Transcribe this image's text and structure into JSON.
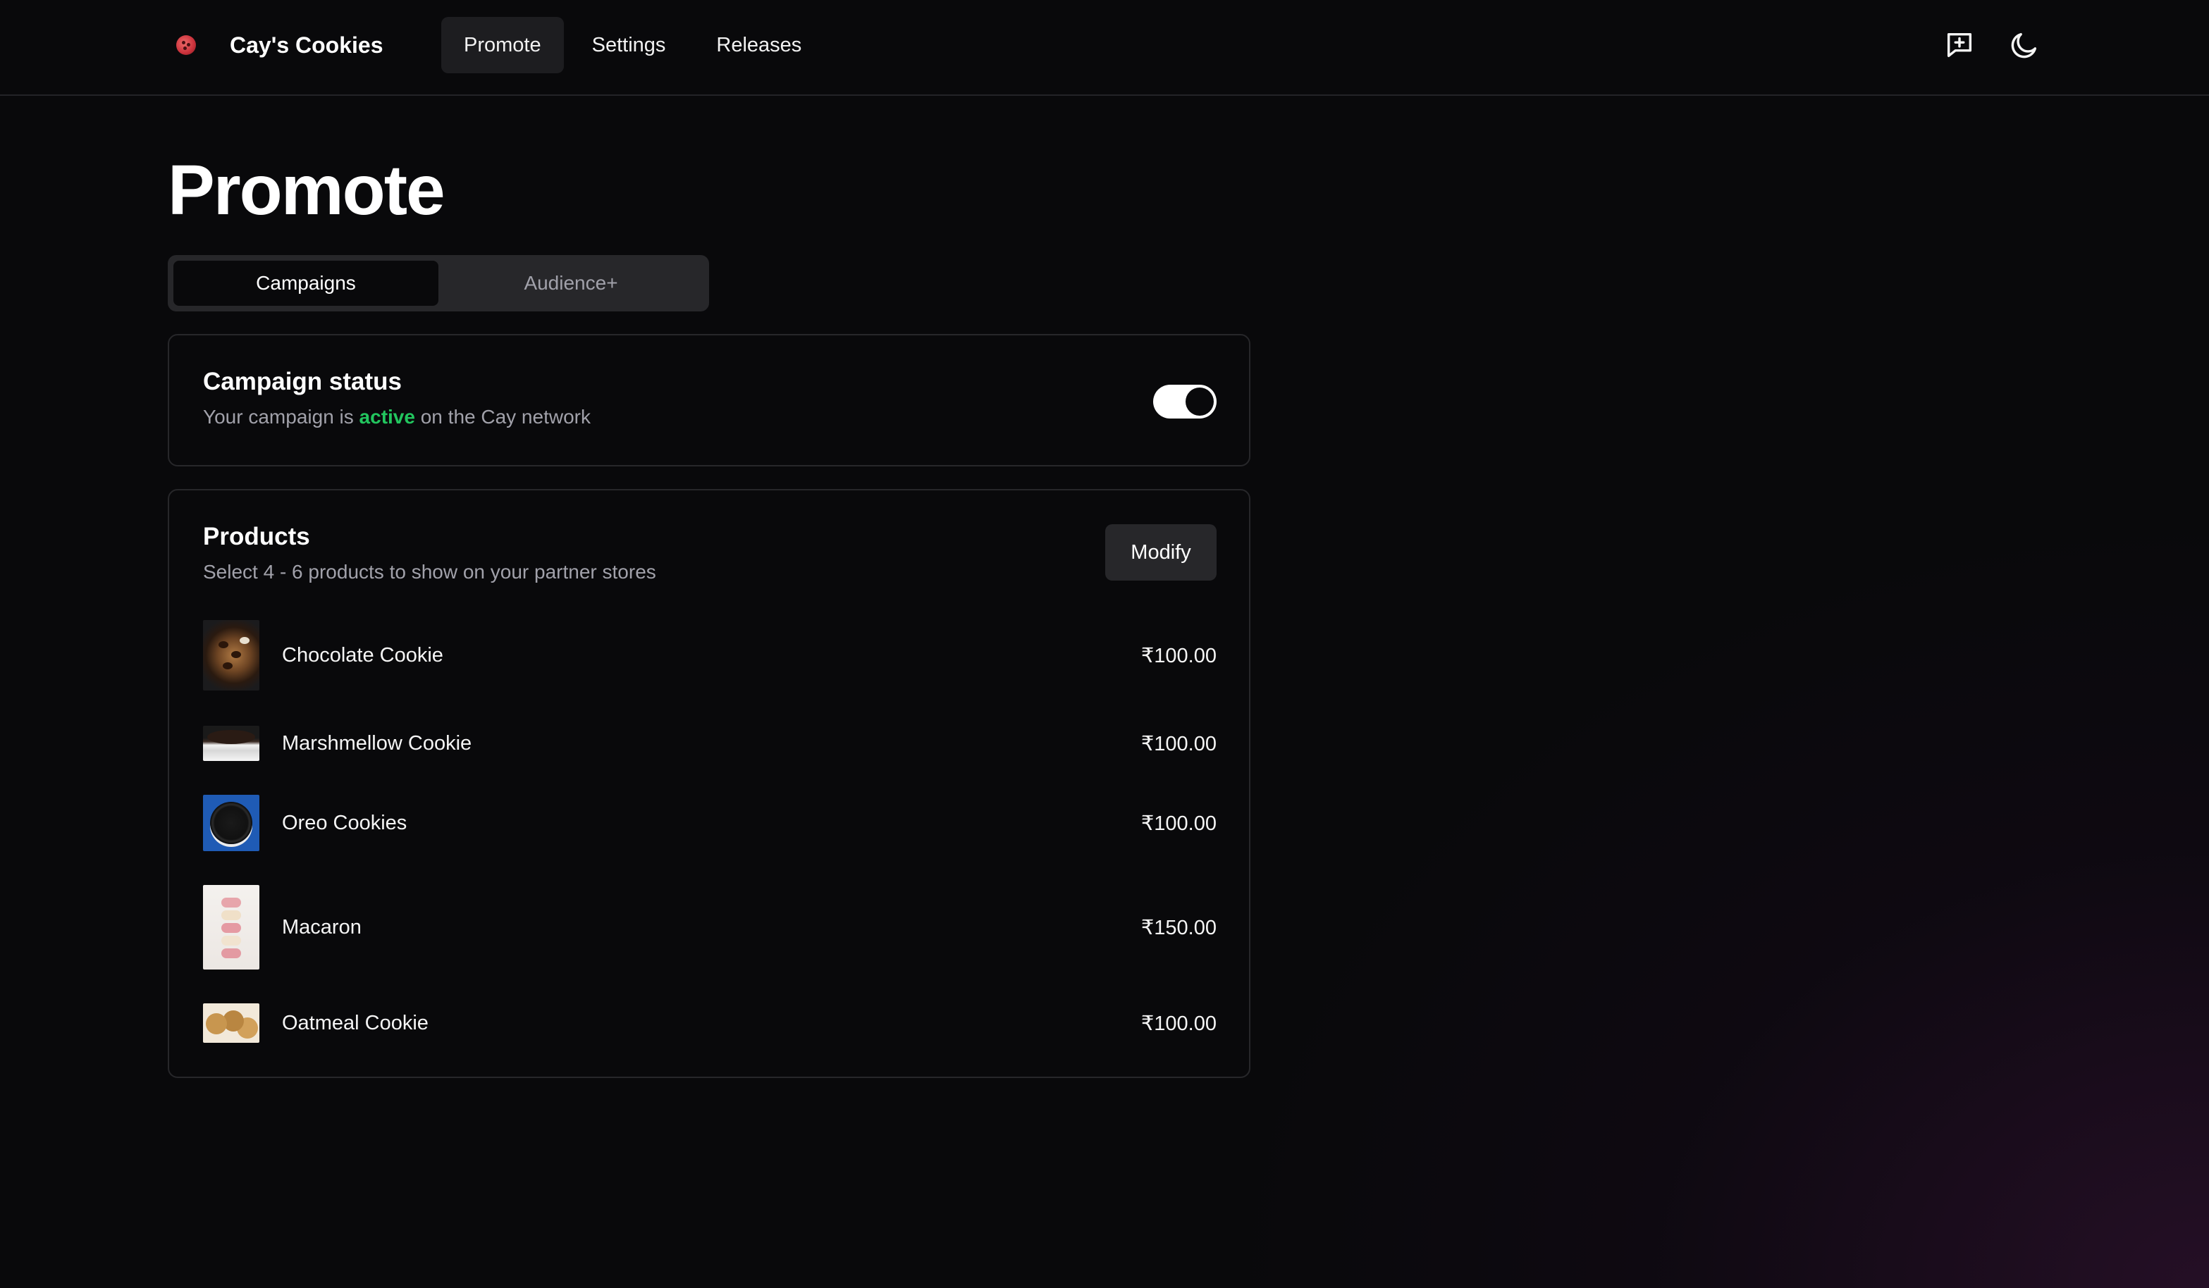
{
  "app": {
    "brand_name": "Cay's Cookies"
  },
  "nav": {
    "items": [
      {
        "label": "Promote",
        "active": true
      },
      {
        "label": "Settings",
        "active": false
      },
      {
        "label": "Releases",
        "active": false
      }
    ]
  },
  "header_icons": [
    "feedback-icon",
    "moon-icon"
  ],
  "page": {
    "title": "Promote"
  },
  "tabs": [
    {
      "label": "Campaigns",
      "active": true
    },
    {
      "label": "Audience+",
      "active": false
    }
  ],
  "campaign_status": {
    "title": "Campaign status",
    "sub_prefix": "Your campaign is",
    "state": "active",
    "sub_suffix": "on the Cay network",
    "toggle_on": true
  },
  "products": {
    "title": "Products",
    "subtitle": "Select 4 - 6 products to show on your partner stores",
    "modify_label": "Modify",
    "items": [
      {
        "name": "Chocolate Cookie",
        "price": "₹100.00"
      },
      {
        "name": "Marshmellow Cookie",
        "price": "₹100.00"
      },
      {
        "name": "Oreo Cookies",
        "price": "₹100.00"
      },
      {
        "name": "Macaron",
        "price": "₹150.00"
      },
      {
        "name": "Oatmeal Cookie",
        "price": "₹100.00"
      }
    ]
  },
  "colors": {
    "background": "#09090b",
    "active_text": "#22c55e",
    "card_border": "#27272a",
    "muted_text": "#a1a1aa"
  }
}
